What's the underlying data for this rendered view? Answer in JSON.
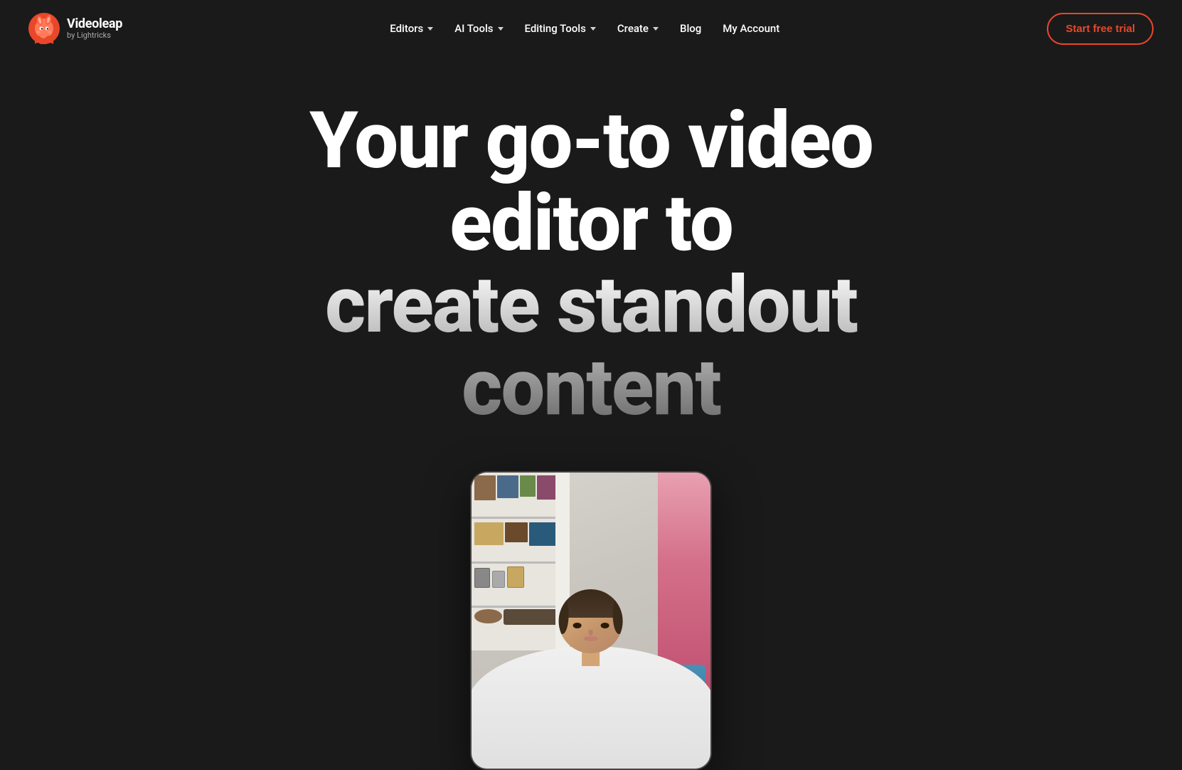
{
  "brand": {
    "name": "Videoleap",
    "sub": "by Lightricks",
    "logo_alt": "Videoleap logo"
  },
  "nav": {
    "items": [
      {
        "label": "Editors",
        "has_dropdown": true
      },
      {
        "label": "AI Tools",
        "has_dropdown": true
      },
      {
        "label": "Editing Tools",
        "has_dropdown": true
      },
      {
        "label": "Create",
        "has_dropdown": true
      },
      {
        "label": "Blog",
        "has_dropdown": false
      },
      {
        "label": "My Account",
        "has_dropdown": false
      }
    ],
    "cta": "Start free trial"
  },
  "hero": {
    "headline_line1": "Your go-to video editor to",
    "headline_line2": "create standout content",
    "headline_full": "Your go-to video editor to create standout content"
  },
  "video_card": {
    "alt": "Video editor preview showing person"
  }
}
